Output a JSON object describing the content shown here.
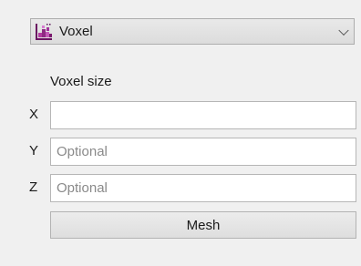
{
  "mode_select": {
    "value": "Voxel",
    "icon": "voxel-grid-icon",
    "icon_colors": [
      "#7a1a6e",
      "#b23aa0",
      "#d77ad0",
      "#5a1458"
    ]
  },
  "voxel_size": {
    "label": "Voxel size",
    "x": {
      "axis": "X",
      "value": "",
      "placeholder": ""
    },
    "y": {
      "axis": "Y",
      "value": "",
      "placeholder": "Optional"
    },
    "z": {
      "axis": "Z",
      "value": "",
      "placeholder": "Optional"
    }
  },
  "actions": {
    "mesh_label": "Mesh"
  }
}
